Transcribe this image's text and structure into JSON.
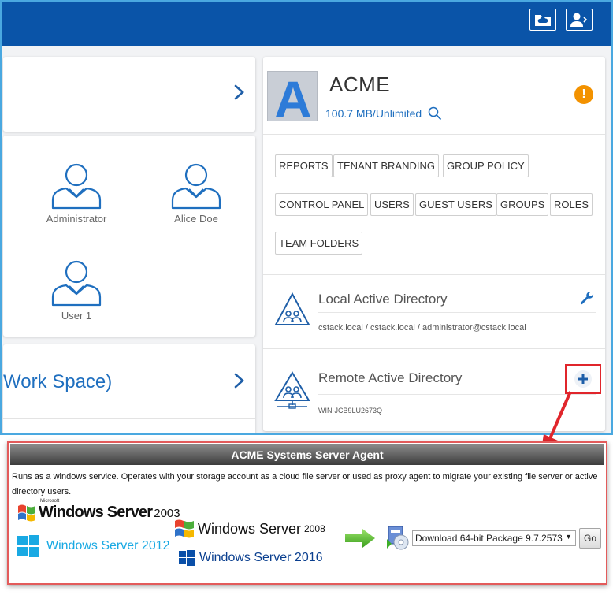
{
  "tenant": {
    "logo_letter": "A",
    "name": "ACME",
    "storage": "100.7 MB/Unlimited",
    "alert_symbol": "!",
    "tags": [
      "REPORTS",
      "TENANT BRANDING",
      "GROUP POLICY",
      "CONTROL PANEL",
      "USERS",
      "GUEST USERS",
      "GROUPS",
      "ROLES",
      "TEAM FOLDERS"
    ]
  },
  "workspaces": {
    "bottom_label": "Work Space)"
  },
  "users": [
    {
      "name": "Administrator"
    },
    {
      "name": "Alice Doe"
    },
    {
      "name": "User 1"
    }
  ],
  "local_ad": {
    "title": "Local Active Directory",
    "details": "cstack.local / cstack.local / administrator@cstack.local"
  },
  "remote_ad": {
    "title": "Remote Active Directory",
    "details": "WIN-JCB9LU2673Q"
  },
  "agent_panel": {
    "title": "ACME Systems Server Agent",
    "description": "Runs as a windows service. Operates with your storage account as a cloud file server or used as proxy agent to migrate your existing file server or active directory users.",
    "os_logos": {
      "ws2003_brand": "Microsoft",
      "ws2003": "Windows Server",
      "ws2003_ver": "2003",
      "ws2008": "Windows Server",
      "ws2008_ver": "2008",
      "ws2012": "Windows Server 2012",
      "ws2016": "Windows Server 2016"
    },
    "package_selected": "Download 64-bit Package 9.7.2573",
    "go_label": "Go"
  },
  "colors": {
    "topbar": "#0a54a8",
    "accent": "#1f6fbf",
    "alert": "#f39200",
    "highlight": "#e0252b"
  }
}
